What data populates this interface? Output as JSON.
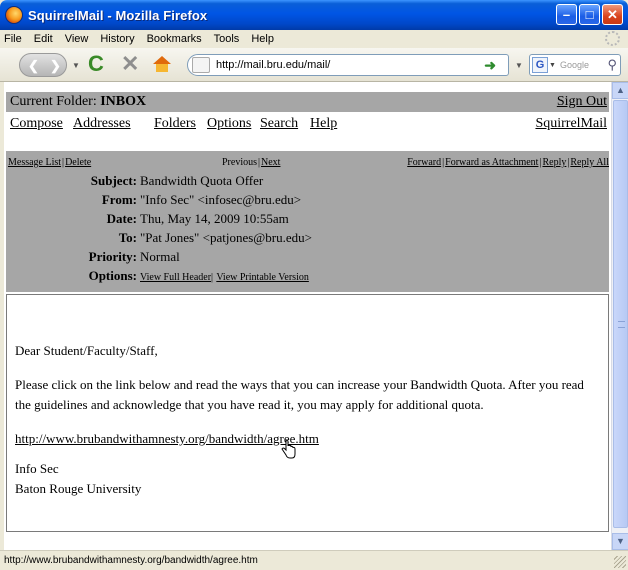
{
  "window": {
    "title": "SquirrelMail - Mozilla Firefox",
    "controls": [
      "minimize",
      "maximize",
      "close"
    ]
  },
  "menu": [
    "File",
    "Edit",
    "View",
    "History",
    "Bookmarks",
    "Tools",
    "Help"
  ],
  "toolbar": {
    "url": "http://mail.bru.edu/mail/",
    "search_placeholder": "Google",
    "search_engine_letter": "G"
  },
  "mail": {
    "folder_label": "Current Folder:",
    "folder_name": "INBOX",
    "sign_out": "Sign Out",
    "nav_links": [
      "Compose",
      "Addresses",
      "Folders",
      "Options",
      "Search",
      "Help"
    ],
    "brand": "SquirrelMail",
    "actions": {
      "message_list": "Message List",
      "delete": "Delete",
      "previous": "Previous",
      "next": "Next",
      "forward": "Forward",
      "forward_attachment": "Forward as Attachment",
      "reply": "Reply",
      "reply_all": "Reply All"
    },
    "headers": {
      "subject_label": "Subject:",
      "subject": "Bandwidth Quota Offer",
      "from_label": "From:",
      "from": "\"Info Sec\" <infosec@bru.edu>",
      "date_label": "Date:",
      "date": "Thu, May 14, 2009 10:55am",
      "to_label": "To:",
      "to": "\"Pat Jones\" <patjones@bru.edu>",
      "priority_label": "Priority:",
      "priority": "Normal",
      "options_label": "Options:",
      "view_full_header": "View Full Header",
      "view_printable": "View Printable Version"
    },
    "body": {
      "greeting": "Dear Student/Faculty/Staff,",
      "paragraph": "Please click on the link below and read the ways that you can increase your Bandwidth Quota. After you read the guidelines and acknowledge that you have read it, you may apply for additional quota.",
      "link": "http://www.brubandwithamnesty.org/bandwidth/agree.htm",
      "signature_line1": "Info Sec",
      "signature_line2": "Baton Rouge University"
    }
  },
  "status": {
    "text": "http://www.brubandwithamnesty.org/bandwidth/agree.htm"
  },
  "colors": {
    "titlebar": "#0055e5",
    "mail_header_gray": "#a6a6a6",
    "chrome": "#ece9d8"
  },
  "icons": [
    "firefox-logo-icon",
    "back-icon",
    "forward-icon",
    "reload-icon",
    "stop-icon",
    "home-icon",
    "go-arrow-icon",
    "search-icon",
    "hand-cursor-icon"
  ]
}
